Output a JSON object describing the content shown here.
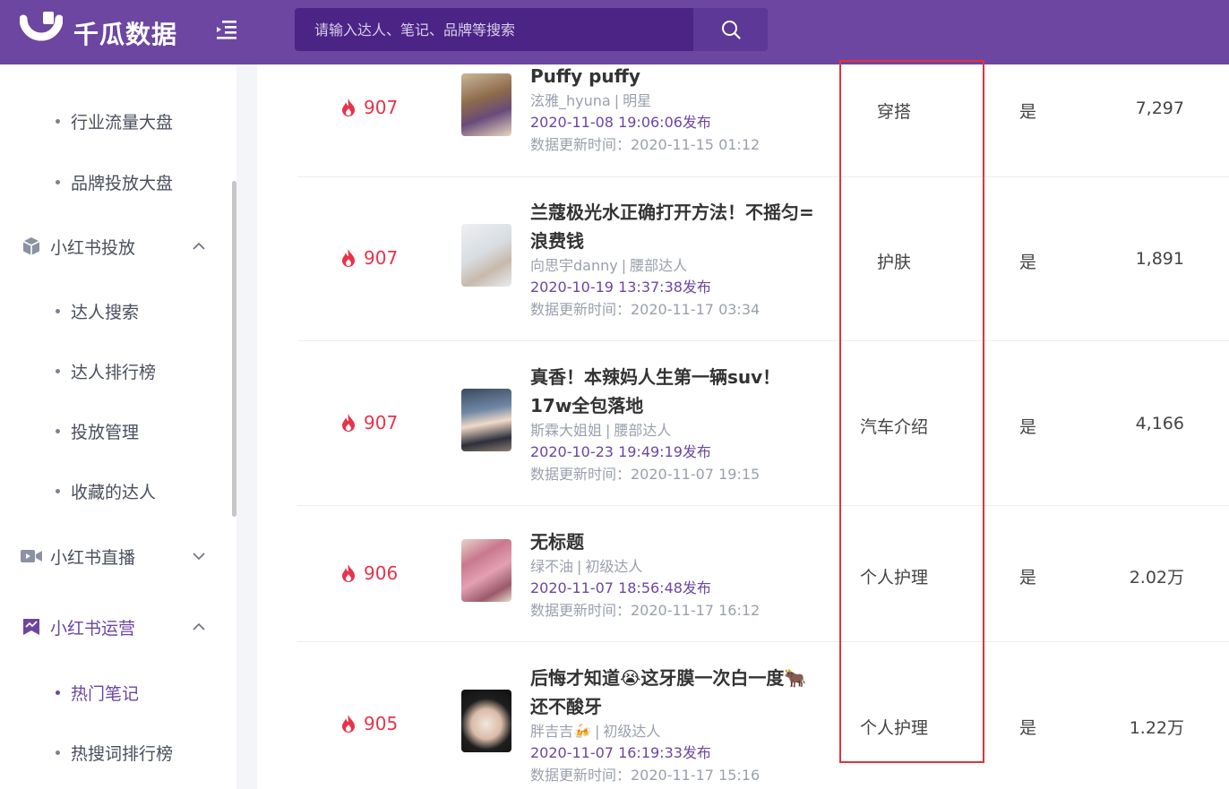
{
  "header": {
    "logo_text": "千瓜数据",
    "search_placeholder": "请输入达人、笔记、品牌等搜索"
  },
  "sidebar": {
    "items": [
      {
        "type": "sub",
        "label": "行业流量大盘"
      },
      {
        "type": "sub",
        "label": "品牌投放大盘"
      },
      {
        "type": "group",
        "label": "小红书投放",
        "icon": "box-icon",
        "expanded": true
      },
      {
        "type": "sub",
        "label": "达人搜索"
      },
      {
        "type": "sub",
        "label": "达人排行榜"
      },
      {
        "type": "sub",
        "label": "投放管理"
      },
      {
        "type": "sub",
        "label": "收藏的达人"
      },
      {
        "type": "group",
        "label": "小红书直播",
        "icon": "video-camera-icon",
        "expanded": false
      },
      {
        "type": "group",
        "label": "小红书运营",
        "icon": "chart-bookmark-icon",
        "expanded": true,
        "active": true
      },
      {
        "type": "sub",
        "label": "热门笔记",
        "active": true
      },
      {
        "type": "sub",
        "label": "热搜词排行榜"
      }
    ]
  },
  "notes": [
    {
      "heat": "907",
      "title": "Puffy puffy",
      "author": "泫雅_hyuna",
      "level": "明星",
      "published": "2020-11-08 19:06:06发布",
      "updated": "数据更新时间：2020-11-15 01:12",
      "category": "穿搭",
      "flag": "是",
      "value": "7,297"
    },
    {
      "heat": "907",
      "title": "兰蔻极光水正确打开方法！不摇匀=浪费钱",
      "author": "向思宇danny",
      "level": "腰部达人",
      "published": "2020-10-19 13:37:38发布",
      "updated": "数据更新时间：2020-11-17 03:34",
      "category": "护肤",
      "flag": "是",
      "value": "1,891"
    },
    {
      "heat": "907",
      "title": "真香！本辣妈人生第一辆suv！17w全包落地",
      "author": "斯霖大姐姐",
      "level": "腰部达人",
      "published": "2020-10-23 19:49:19发布",
      "updated": "数据更新时间：2020-11-07 19:15",
      "category": "汽车介绍",
      "flag": "是",
      "value": "4,166"
    },
    {
      "heat": "906",
      "title": "无标题",
      "author": "绿不油",
      "level": "初级达人",
      "published": "2020-11-07 18:56:48发布",
      "updated": "数据更新时间：2020-11-17 16:12",
      "category": "个人护理",
      "flag": "是",
      "value": "2.02万"
    },
    {
      "heat": "905",
      "title": "后悔才知道😭这牙膜一次白一度🐂还不酸牙",
      "author": "胖吉吉🍻",
      "level": "初级达人",
      "published": "2020-11-07 16:19:33发布",
      "updated": "数据更新时间：2020-11-17 15:16",
      "category": "个人护理",
      "flag": "是",
      "value": "1.22万"
    }
  ],
  "colors": {
    "brand": "#6c46a1",
    "heat": "#e8334b",
    "highlight_box": "#e0343b"
  }
}
